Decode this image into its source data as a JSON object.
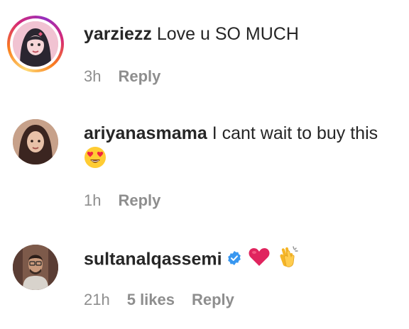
{
  "comments": [
    {
      "username": "yarziezz",
      "text": "Love u SO MUCH",
      "time": "3h",
      "reply_label": "Reply",
      "has_story_ring": true
    },
    {
      "username": "ariyanasmama",
      "text": "I cant wait to buy this",
      "emoji": "heart-eyes-emoji",
      "time": "1h",
      "reply_label": "Reply",
      "has_story_ring": false
    },
    {
      "username": "sultanalqassemi",
      "verified": true,
      "emojis": [
        "red-heart-emoji",
        "clapping-hands-emoji"
      ],
      "time": "21h",
      "likes_label": "5 likes",
      "reply_label": "Reply",
      "has_story_ring": false
    }
  ],
  "colors": {
    "text": "#262626",
    "meta": "#8e8e8e",
    "verified_blue": "#3897f0",
    "heart_red": "#e0245e"
  }
}
